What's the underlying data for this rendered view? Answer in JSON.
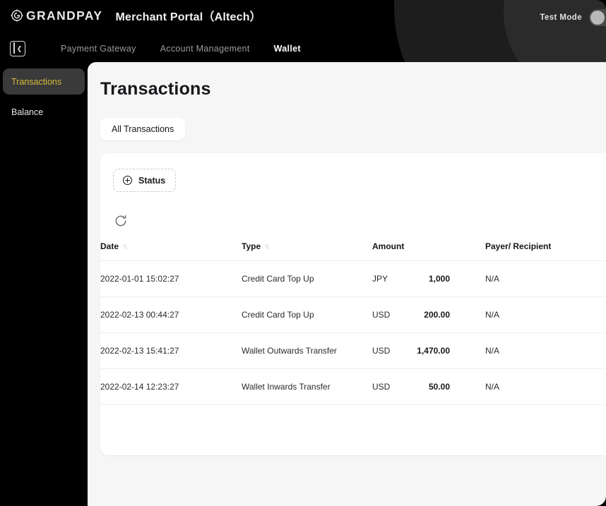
{
  "header": {
    "logo_text": "GRANDPAY",
    "logo_icon": "grandpay-circle-logo-icon",
    "portal_title": "Merchant Portal（Altech）",
    "test_mode_label": "Test Mode",
    "test_mode_toggle": "off",
    "collapse_icon": "sidebar-collapse-icon",
    "nav": [
      {
        "label": "Payment Gateway",
        "active": false
      },
      {
        "label": "Account Management",
        "active": false
      },
      {
        "label": "Wallet",
        "active": true
      }
    ]
  },
  "sidebar": {
    "items": [
      {
        "label": "Transactions",
        "active": true
      },
      {
        "label": "Balance",
        "active": false
      }
    ],
    "active_color": "#d8bb3c",
    "active_bg": "#3a3a3a"
  },
  "main": {
    "page_title": "Transactions",
    "tabs": [
      {
        "label": "All Transactions",
        "active": true
      }
    ],
    "filters": {
      "status_label": "Status",
      "status_icon": "plus-circle-icon"
    },
    "refresh_icon": "refresh-icon",
    "table": {
      "columns": [
        {
          "key": "date",
          "label": "Date",
          "sortable": true,
          "sort_icon": "sort-updown-icon"
        },
        {
          "key": "type",
          "label": "Type",
          "sortable": true,
          "sort_icon": "sort-updown-icon"
        },
        {
          "key": "amount",
          "label": "Amount",
          "sortable": false
        },
        {
          "key": "payer",
          "label": "Payer/ Recipient",
          "sortable": false
        }
      ],
      "rows": [
        {
          "date": "2022-01-01 15:02:27",
          "type": "Credit Card Top Up",
          "currency": "JPY",
          "amount": "1,000",
          "payer": "N/A"
        },
        {
          "date": "2022-02-13 00:44:27",
          "type": "Credit Card Top Up",
          "currency": "USD",
          "amount": "200.00",
          "payer": "N/A"
        },
        {
          "date": "2022-02-13 15:41:27",
          "type": "Wallet Outwards Transfer",
          "currency": "USD",
          "amount": "1,470.00",
          "payer": "N/A"
        },
        {
          "date": "2022-02-14 12:23:27",
          "type": "Wallet Inwards Transfer",
          "currency": "USD",
          "amount": "50.00",
          "payer": "N/A"
        }
      ]
    }
  }
}
